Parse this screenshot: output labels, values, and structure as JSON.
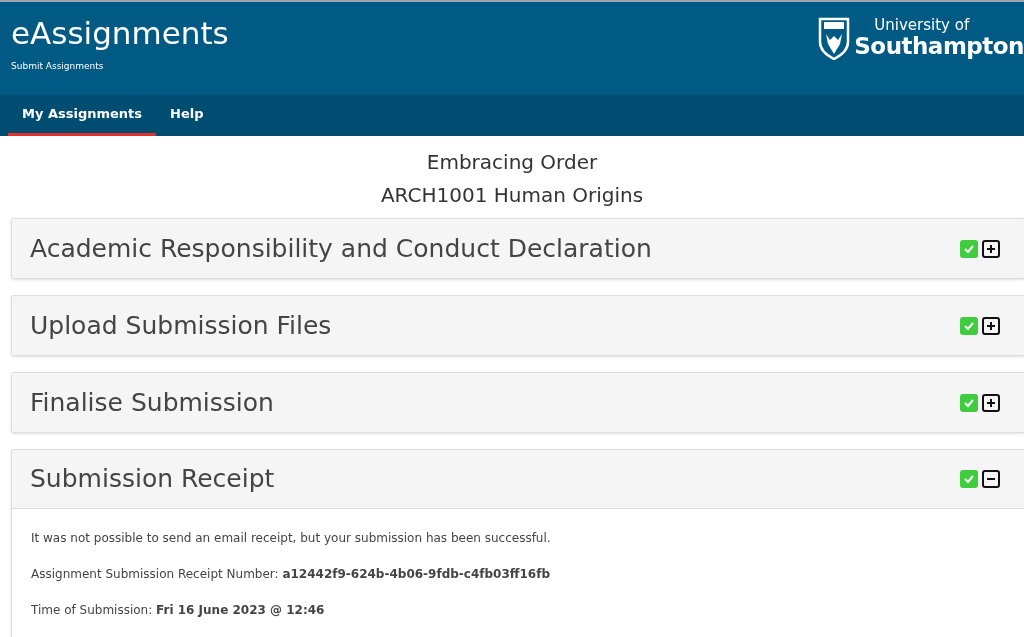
{
  "header": {
    "title": "eAssignments",
    "subtitle": "Submit Assignments",
    "logo": {
      "line_1": "University of",
      "line_2": "Southampton"
    }
  },
  "nav": [
    {
      "label": "My Assignments",
      "selected": true
    },
    {
      "label": "Help",
      "selected": false
    }
  ],
  "assignment": {
    "title": "Embracing Order",
    "module": "ARCH1001 Human Origins"
  },
  "sections": [
    {
      "title": "Academic Responsibility and Conduct Declaration",
      "complete": true,
      "expanded": false
    },
    {
      "title": "Upload Submission Files",
      "complete": true,
      "expanded": false
    },
    {
      "title": "Finalise Submission",
      "complete": true,
      "expanded": false
    },
    {
      "title": "Submission Receipt",
      "complete": true,
      "expanded": true,
      "lines": [
        "It was not possible to send an email receipt, but your submission has been successful.",
        "Assignment Submission Receipt Number: **a12442f9-624b-4b06-9fdb-c4fb03ff16fb**",
        "Time of Submission: **Fri 16 June 2023 @ 12:46**"
      ]
    }
  ]
}
